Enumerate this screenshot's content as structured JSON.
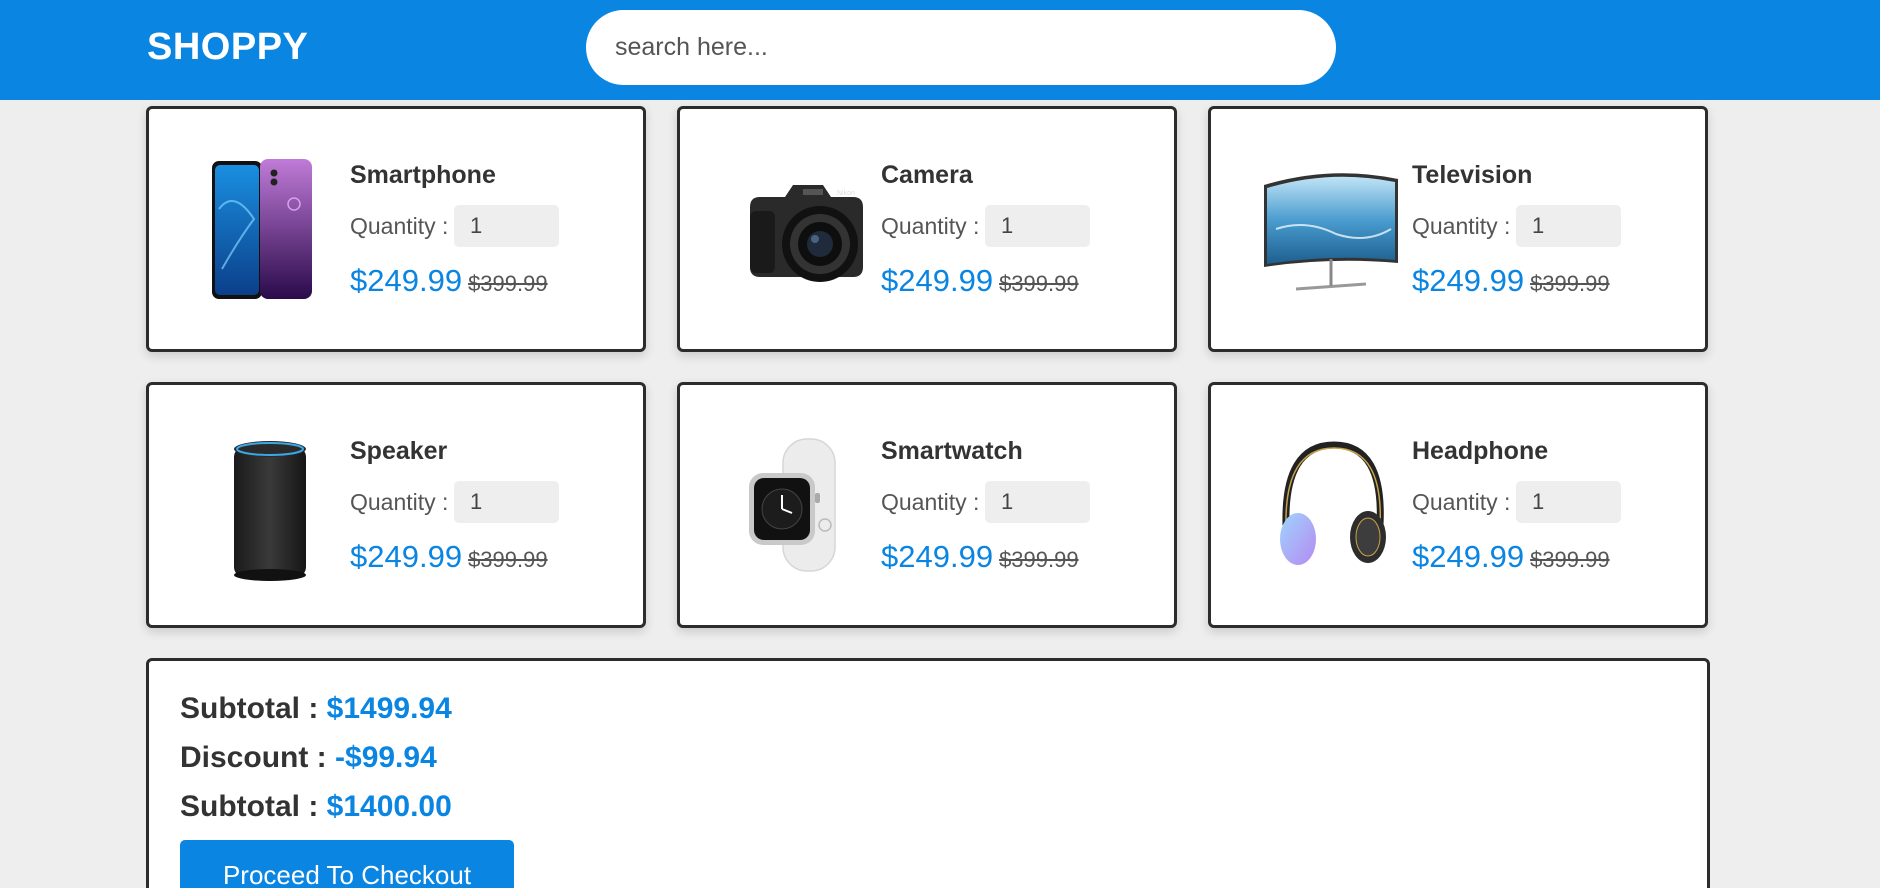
{
  "header": {
    "logo": "SHOPPY",
    "search_placeholder": "search here..."
  },
  "products": [
    {
      "name": "Smartphone",
      "quantity_label": "Quantity :",
      "quantity": "1",
      "price": "$249.99",
      "old_price": "$399.99",
      "icon": "smartphone-image"
    },
    {
      "name": "Camera",
      "quantity_label": "Quantity :",
      "quantity": "1",
      "price": "$249.99",
      "old_price": "$399.99",
      "icon": "camera-image"
    },
    {
      "name": "Television",
      "quantity_label": "Quantity :",
      "quantity": "1",
      "price": "$249.99",
      "old_price": "$399.99",
      "icon": "television-image"
    },
    {
      "name": "Speaker",
      "quantity_label": "Quantity :",
      "quantity": "1",
      "price": "$249.99",
      "old_price": "$399.99",
      "icon": "speaker-image"
    },
    {
      "name": "Smartwatch",
      "quantity_label": "Quantity :",
      "quantity": "1",
      "price": "$249.99",
      "old_price": "$399.99",
      "icon": "smartwatch-image"
    },
    {
      "name": "Headphone",
      "quantity_label": "Quantity :",
      "quantity": "1",
      "price": "$249.99",
      "old_price": "$399.99",
      "icon": "headphone-image"
    }
  ],
  "summary": {
    "subtotal_label": "Subtotal :",
    "subtotal_value": "$1499.94",
    "discount_label": "Discount :",
    "discount_value": "-$99.94",
    "total_label": "Subtotal :",
    "total_value": "$1400.00",
    "checkout_label": "Proceed To Checkout"
  },
  "colors": {
    "accent": "#0a85e2",
    "background": "#eeeeee",
    "card_border": "#2c2c2c"
  }
}
